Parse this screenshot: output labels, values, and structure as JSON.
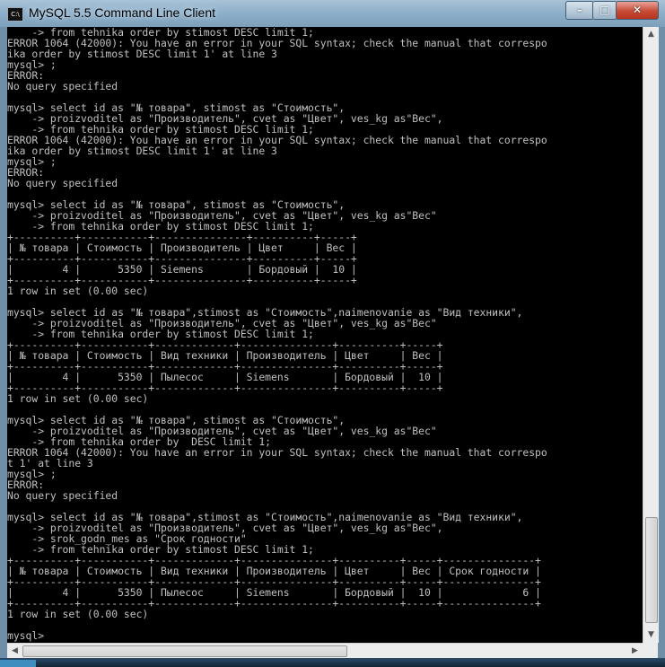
{
  "window": {
    "title": "MySQL 5.5 Command Line Client",
    "app_icon": "cmd-icon",
    "controls": {
      "minimize": "–",
      "maximize": "□",
      "close": "✕"
    }
  },
  "console": {
    "lines": [
      "    -> from tehnika order by stimost DESC limit 1;",
      "ERROR 1064 (42000): You have an error in your SQL syntax; check the manual that correspo",
      "ika order by stimost DESC limit 1' at line 3",
      "mysql> ;",
      "ERROR:",
      "No query specified",
      "",
      "mysql> select id as \"№ товара\", stimost as \"Стоимость\",",
      "    -> proizvoditel as \"Производитель\", cvet as \"Цвет\", ves_kg as\"Вес\",",
      "    -> from tehnika order by stimost DESC limit 1;",
      "ERROR 1064 (42000): You have an error in your SQL syntax; check the manual that correspo",
      "ika order by stimost DESC limit 1' at line 3",
      "mysql> ;",
      "ERROR:",
      "No query specified",
      "",
      "mysql> select id as \"№ товара\", stimost as \"Стоимость\",",
      "    -> proizvoditel as \"Производитель\", cvet as \"Цвет\", ves_kg as\"Вес\"",
      "    -> from tehnika order by stimost DESC limit 1;",
      "+----------+-----------+---------------+----------+-----+",
      "| № товара | Стоимость | Производитель | Цвет     | Вес |",
      "+----------+-----------+---------------+----------+-----+",
      "|        4 |      5350 | Siemens       | Бордовый |  10 |",
      "+----------+-----------+---------------+----------+-----+",
      "1 row in set (0.00 sec)",
      "",
      "mysql> select id as \"№ товара\",stimost as \"Стоимость\",naimenovanie as \"Вид техники\",",
      "    -> proizvoditel as \"Производитель\", cvet as \"Цвет\", ves_kg as\"Вес\"",
      "    -> from tehnika order by stimost DESC limit 1;",
      "+----------+-----------+-------------+---------------+----------+-----+",
      "| № товара | Стоимость | Вид техники | Производитель | Цвет     | Вес |",
      "+----------+-----------+-------------+---------------+----------+-----+",
      "|        4 |      5350 | Пылесос     | Siemens       | Бордовый |  10 |",
      "+----------+-----------+-------------+---------------+----------+-----+",
      "1 row in set (0.00 sec)",
      "",
      "mysql> select id as \"№ товара\", stimost as \"Стоимость\",",
      "    -> proizvoditel as \"Производитель\", cvet as \"Цвет\", ves_kg as\"Вес\"",
      "    -> from tehnika order by  DESC limit 1;",
      "ERROR 1064 (42000): You have an error in your SQL syntax; check the manual that correspo",
      "t 1' at line 3",
      "mysql> ;",
      "ERROR:",
      "No query specified",
      "",
      "mysql> select id as \"№ товара\",stimost as \"Стоимость\",naimenovanie as \"Вид техники\",",
      "    -> proizvoditel as \"Производитель\", cvet as \"Цвет\", ves_kg as\"Вес\",",
      "    -> srok_godn_mes as \"Срок годности\"",
      "    -> from tehnika order by stimost DESC limit 1;",
      "+----------+-----------+-------------+---------------+----------+-----+---------------+",
      "| № товара | Стоимость | Вид техники | Производитель | Цвет     | Вес | Срок годности |",
      "+----------+-----------+-------------+---------------+----------+-----+---------------+",
      "|        4 |      5350 | Пылесос     | Siemens       | Бордовый |  10 |             6 |",
      "+----------+-----------+-------------+---------------+----------+-----+---------------+",
      "1 row in set (0.00 sec)",
      "",
      "mysql>"
    ]
  },
  "scrollbars": {
    "up_arrow": "▲",
    "down_arrow": "▼",
    "left_arrow": "◀",
    "right_arrow": "▶"
  }
}
